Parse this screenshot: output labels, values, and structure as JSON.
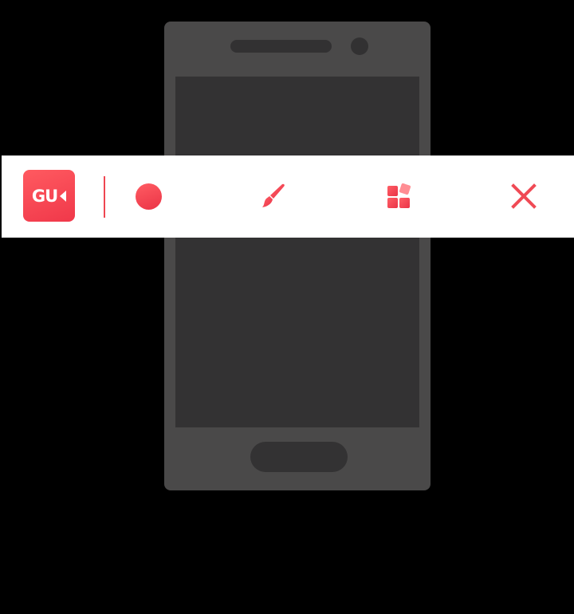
{
  "app": {
    "logo_text": "GU",
    "logo_icon": "video-camera-icon"
  },
  "toolbar": {
    "buttons": [
      {
        "name": "record",
        "icon": "record-dot-icon"
      },
      {
        "name": "brush",
        "icon": "paintbrush-icon"
      },
      {
        "name": "tools",
        "icon": "grid-tools-icon"
      },
      {
        "name": "close",
        "icon": "close-icon"
      }
    ]
  },
  "colors": {
    "accent": "#f0384a",
    "toolbar_bg": "#ffffff",
    "phone_body": "#4a4949",
    "phone_screen": "#333233",
    "background": "#000000"
  }
}
